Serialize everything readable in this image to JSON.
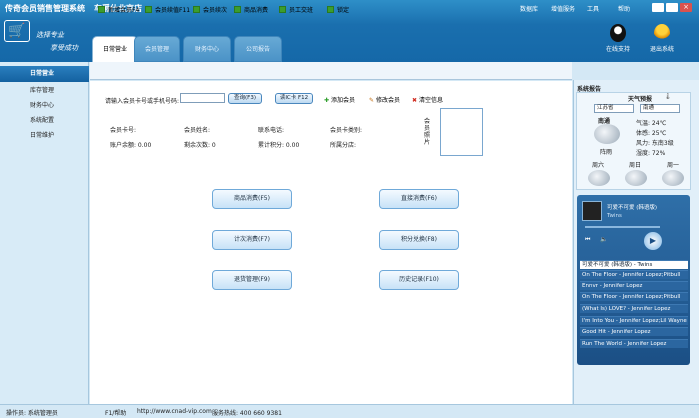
{
  "header": {
    "app_title": "传奇会员销售管理系统",
    "store_name": "车爵仕北京店",
    "links": [
      "数据库",
      "增值服务",
      "工具",
      "帮助"
    ],
    "slogan_1": "选择专业",
    "slogan_2": "享受成功",
    "online_support": "在线支持",
    "exit_system": "退出系统"
  },
  "tabs": [
    "日常营业",
    "会员管理",
    "财务中心",
    "公司报告"
  ],
  "sidebar": {
    "items": [
      "日常营业",
      "库存管理",
      "财务中心",
      "系统配置",
      "日常维护"
    ]
  },
  "toolbar": {
    "items": [
      "新增会员F4",
      "会员续值F11",
      "会员续次",
      "商品消费",
      "员工交班",
      "锁定"
    ]
  },
  "form": {
    "input_label": "请输入会员卡号或手机号码:",
    "card_input_value": "",
    "query_button": "查询(F3)",
    "read_card_button": "读IC卡 F12",
    "add_member": "添加会员",
    "edit_member": "修改会员",
    "clear_info": "清空信息",
    "fields_row1": [
      "会员卡号:",
      "会员姓名:",
      "联系电话:",
      "会员卡类别:"
    ],
    "fields_row2": [
      "账户余额: 0.00",
      "剩余次数: 0",
      "累计积分: 0.00",
      "所属分店:"
    ],
    "photo_label": "会员照片"
  },
  "buttons": {
    "goods_consume": "商品消费(F5)",
    "quick_consume": "直接消费(F6)",
    "count_consume": "计次消费(F7)",
    "points_exchange": "积分兑换(F8)",
    "return_manage": "退货管理(F9)",
    "history": "历史记录(F10)"
  },
  "right_panel": {
    "title": "系统报告",
    "weather_title": "天气预报",
    "province": "江苏省",
    "city": "南通",
    "city_label": "南通",
    "condition": "阵雨",
    "temp": "气温: 24℃",
    "feel": "体感: 25℃",
    "wind": "风力: 东南3级",
    "humidity": "湿度: 72%",
    "days": [
      "周六",
      "周日",
      "周一"
    ]
  },
  "music": {
    "now_playing": "可爱不可爱 (韩语版)",
    "artist": "Twins",
    "tracks": [
      "可爱不可爱 (韩语版) - Twins",
      "On The Floor - Jennifer Lopez;Pitbull",
      "Ennvr - Jennifer Lopez",
      "On The Floor - Jennifer Lopez;Pitbull",
      "(What Is) LOVE? - Jennifer Lopez",
      "I'm Into You - Jennifer Lopez;Lil Wayne",
      "Good Hit - Jennifer Lopez",
      "Run The World - Jennifer Lopez"
    ]
  },
  "status_bar": {
    "operator": "操作员: 系统管理员",
    "help": "F1/帮助",
    "url": "http://www.cnad-vip.com",
    "hotline": "服务热线: 400 660 9381"
  },
  "colors": {
    "header": "#1a6fae",
    "accent": "#1461a0",
    "background": "#d4e8f5"
  }
}
